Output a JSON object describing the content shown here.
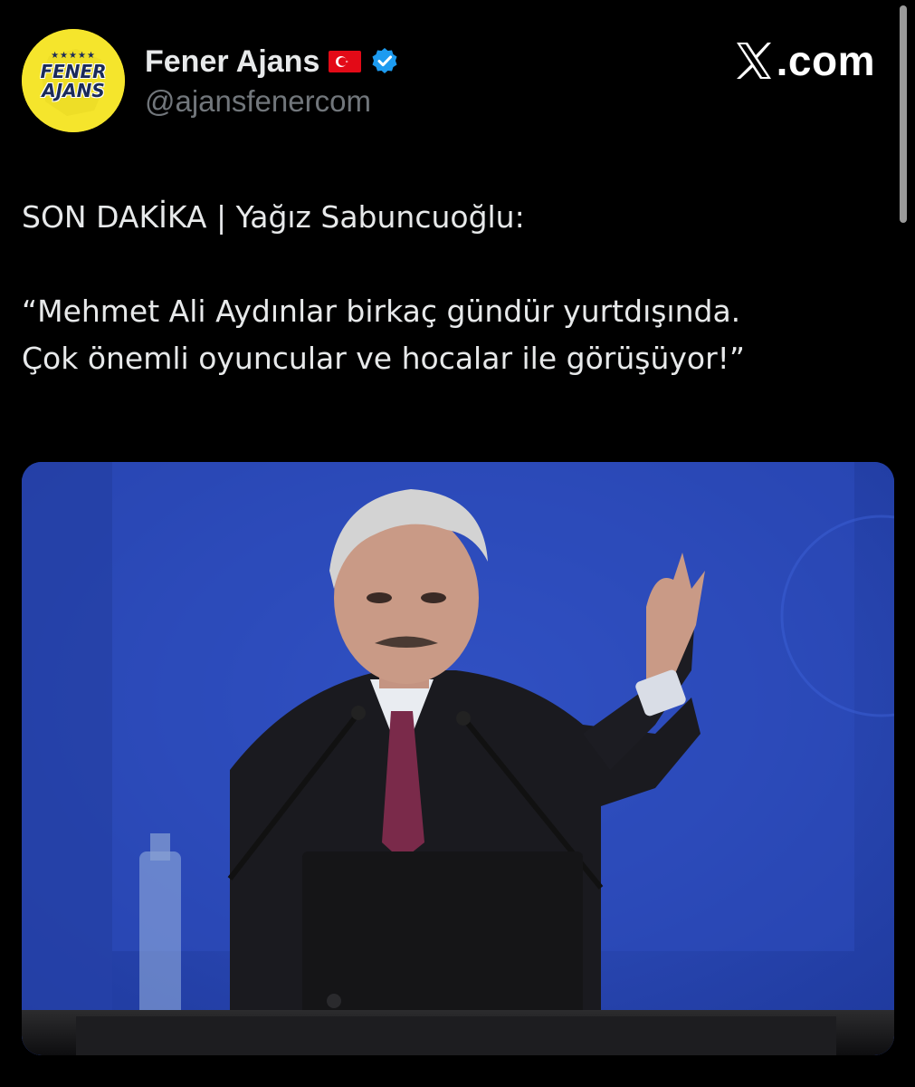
{
  "account": {
    "avatar": {
      "logo_line1": "FENER",
      "logo_line2": "AJANS",
      "stars": "★★★★★",
      "background_color": "#f5e52c",
      "text_color": "#1b2b5a"
    },
    "display_name": "Fener Ajans",
    "flag_icon": "turkey-flag-icon",
    "verified_icon": "verified-badge-icon",
    "verified_color": "#1d9bf0",
    "handle": "@ajansfenercom"
  },
  "brand": {
    "label": ".com",
    "icon": "x-logo-icon"
  },
  "tweet": {
    "headline": "SON DAKİKA | Yağız Sabuncuoğlu:",
    "quote_line1": "“Mehmet Ali Aydınlar birkaç gündür yurtdışında.",
    "quote_line2": "Çok önemli oyuncular ve hocalar ile görüşüyor!”"
  },
  "media": {
    "description_icon": "photo-speaker-at-podium",
    "background_color": "#2b48b6"
  },
  "colors": {
    "background": "#000000",
    "primary_text": "#e7e9ea",
    "secondary_text": "#71767b"
  }
}
